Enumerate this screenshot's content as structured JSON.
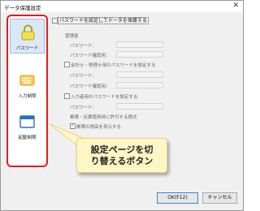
{
  "window": {
    "title": "データ保護設定",
    "close": "✕"
  },
  "sidebar": {
    "items": [
      {
        "label": "パスワード",
        "icon": "lock-icon",
        "selected": true
      },
      {
        "label": "入力制限",
        "icon": "keyboard-icon",
        "selected": false
      },
      {
        "label": "起動制限",
        "icon": "window-icon",
        "selected": false
      }
    ]
  },
  "form": {
    "protect_label": "パスワードを設定してデータを保護する",
    "admin_heading": "管理者",
    "admin_password": "パスワード：",
    "admin_confirm": "パスワード確認用：",
    "accountant_checkbox": "会計士・税理士用のパスワードを設定する",
    "accountant_password": "パスワード：",
    "accountant_confirm": "パスワード確認用：",
    "input_checkbox": "入力者用のパスワードを設定する",
    "input_password": "パスワード：",
    "permitted_forms": "帳簿・伝票使用時に許可する様式",
    "show_ledger_remaining": "帳簿の残高を表示する"
  },
  "callout": {
    "line1": "設定ページを切",
    "line2": "り替えるボタン"
  },
  "footer": {
    "ok_label": "OK(F12)",
    "cancel_label": "キャンセル"
  },
  "colors": {
    "highlight_border": "#e41b1b",
    "callout_bg": "#fff6c6",
    "selected_bg": "#dbe8f7"
  }
}
